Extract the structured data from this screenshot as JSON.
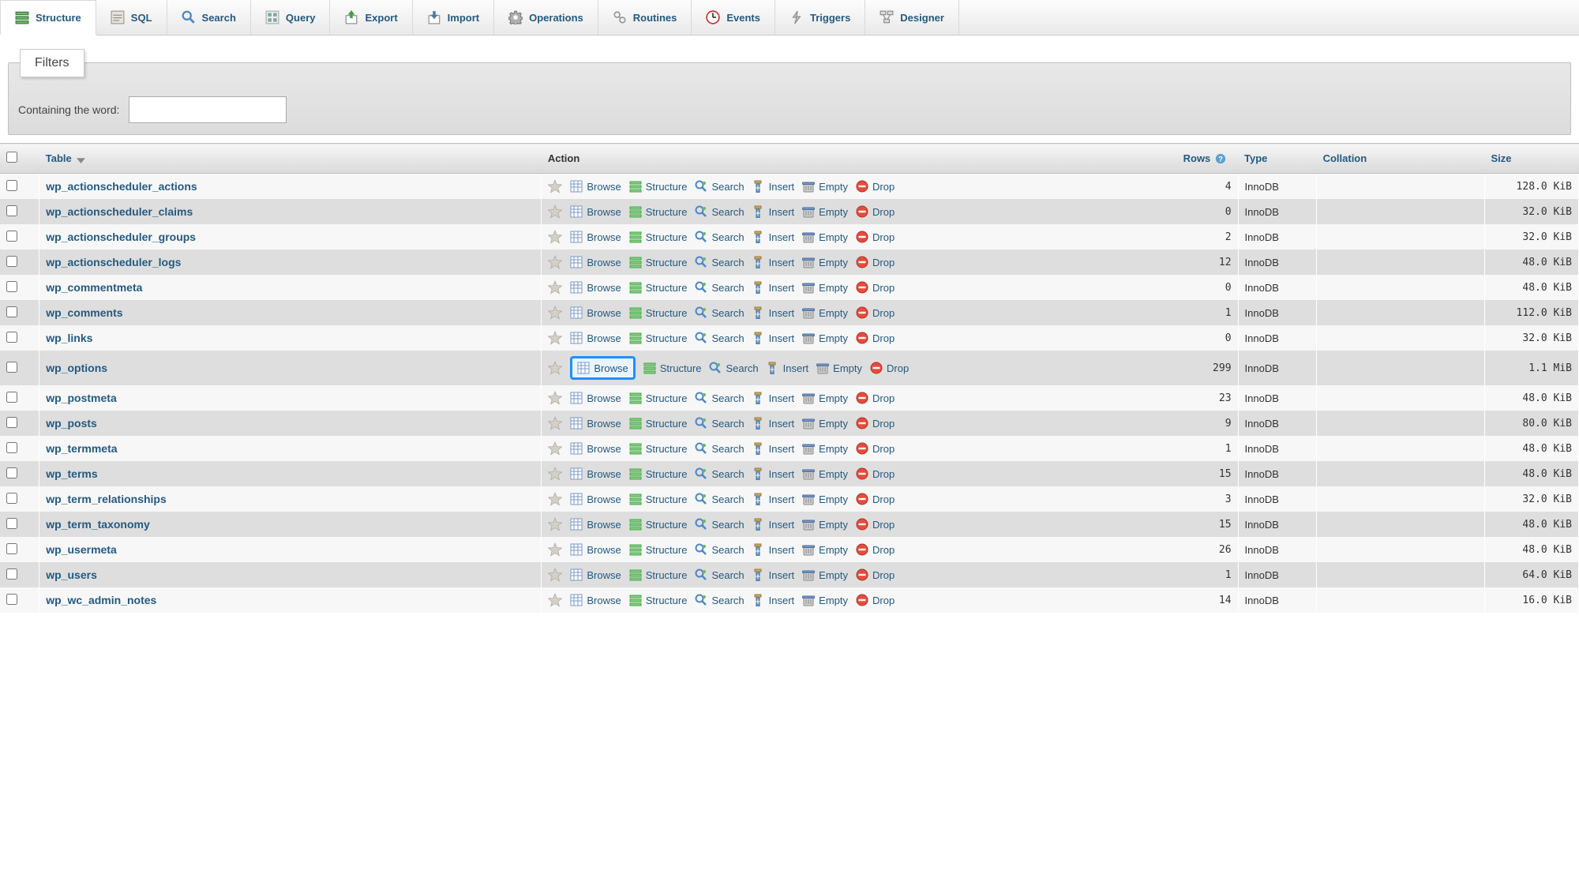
{
  "tabs": [
    {
      "key": "structure",
      "label": "Structure"
    },
    {
      "key": "sql",
      "label": "SQL"
    },
    {
      "key": "search",
      "label": "Search"
    },
    {
      "key": "query",
      "label": "Query"
    },
    {
      "key": "export",
      "label": "Export"
    },
    {
      "key": "import",
      "label": "Import"
    },
    {
      "key": "operations",
      "label": "Operations"
    },
    {
      "key": "routines",
      "label": "Routines"
    },
    {
      "key": "events",
      "label": "Events"
    },
    {
      "key": "triggers",
      "label": "Triggers"
    },
    {
      "key": "designer",
      "label": "Designer"
    }
  ],
  "active_tab": "structure",
  "filter": {
    "legend": "Filters",
    "label": "Containing the word:",
    "value": ""
  },
  "columns": {
    "table": "Table",
    "action": "Action",
    "rows": "Rows",
    "type": "Type",
    "collation": "Collation",
    "size": "Size"
  },
  "action_labels": {
    "browse": "Browse",
    "structure": "Structure",
    "search": "Search",
    "insert": "Insert",
    "empty": "Empty",
    "drop": "Drop"
  },
  "highlighted": {
    "table": "wp_options",
    "action": "browse"
  },
  "tables": [
    {
      "name": "wp_actionscheduler_actions",
      "rows": 4,
      "type": "InnoDB",
      "size": "128.0 KiB"
    },
    {
      "name": "wp_actionscheduler_claims",
      "rows": 0,
      "type": "InnoDB",
      "size": "32.0 KiB"
    },
    {
      "name": "wp_actionscheduler_groups",
      "rows": 2,
      "type": "InnoDB",
      "size": "32.0 KiB"
    },
    {
      "name": "wp_actionscheduler_logs",
      "rows": 12,
      "type": "InnoDB",
      "size": "48.0 KiB"
    },
    {
      "name": "wp_commentmeta",
      "rows": 0,
      "type": "InnoDB",
      "size": "48.0 KiB"
    },
    {
      "name": "wp_comments",
      "rows": 1,
      "type": "InnoDB",
      "size": "112.0 KiB"
    },
    {
      "name": "wp_links",
      "rows": 0,
      "type": "InnoDB",
      "size": "32.0 KiB"
    },
    {
      "name": "wp_options",
      "rows": 299,
      "type": "InnoDB",
      "size": "1.1 MiB"
    },
    {
      "name": "wp_postmeta",
      "rows": 23,
      "type": "InnoDB",
      "size": "48.0 KiB"
    },
    {
      "name": "wp_posts",
      "rows": 9,
      "type": "InnoDB",
      "size": "80.0 KiB"
    },
    {
      "name": "wp_termmeta",
      "rows": 1,
      "type": "InnoDB",
      "size": "48.0 KiB"
    },
    {
      "name": "wp_terms",
      "rows": 15,
      "type": "InnoDB",
      "size": "48.0 KiB"
    },
    {
      "name": "wp_term_relationships",
      "rows": 3,
      "type": "InnoDB",
      "size": "32.0 KiB"
    },
    {
      "name": "wp_term_taxonomy",
      "rows": 15,
      "type": "InnoDB",
      "size": "48.0 KiB"
    },
    {
      "name": "wp_usermeta",
      "rows": 26,
      "type": "InnoDB",
      "size": "48.0 KiB"
    },
    {
      "name": "wp_users",
      "rows": 1,
      "type": "InnoDB",
      "size": "64.0 KiB"
    },
    {
      "name": "wp_wc_admin_notes",
      "rows": 14,
      "type": "InnoDB",
      "size": "16.0 KiB"
    }
  ]
}
